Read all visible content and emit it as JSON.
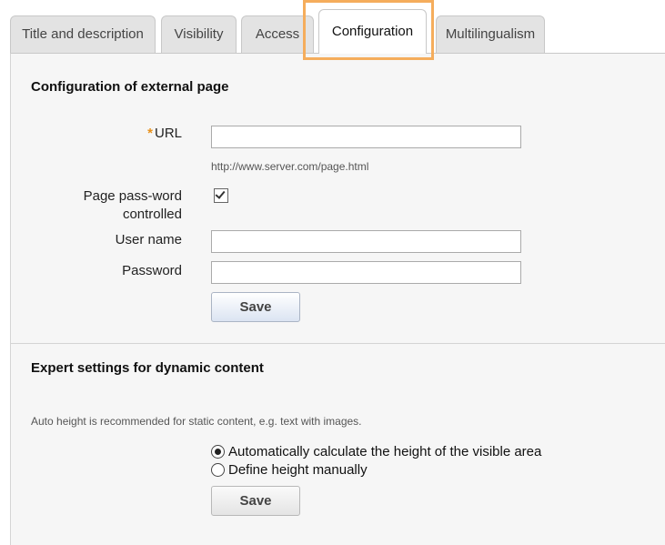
{
  "tabs": [
    {
      "label": "Title and description"
    },
    {
      "label": "Visibility"
    },
    {
      "label": "Access"
    },
    {
      "label": "Configuration"
    },
    {
      "label": "Multilingualism"
    }
  ],
  "external_page": {
    "title": "Configuration of external page",
    "url_required_marker": "*",
    "url_label": "URL",
    "url_value": "",
    "url_hint": "http://www.server.com/page.html",
    "password_controlled_label_line1": "Page pass-word",
    "password_controlled_label_line2": "controlled",
    "password_controlled_checked": true,
    "username_label": "User name",
    "username_value": "",
    "password_label": "Password",
    "password_value": "",
    "save_label": "Save"
  },
  "expert": {
    "title": "Expert settings for dynamic content",
    "hint": "Auto height is recommended for static content, e.g. text with images.",
    "option_auto": "Automatically calculate the height of the visible area",
    "option_manual": "Define height manually",
    "selected": "auto",
    "save_label": "Save"
  },
  "colors": {
    "highlight": "#f5ad5c",
    "required": "#e8901a",
    "panel_bg": "#f6f6f6"
  }
}
